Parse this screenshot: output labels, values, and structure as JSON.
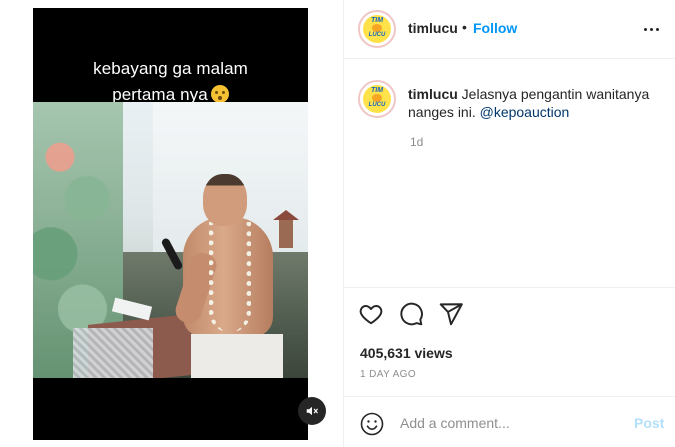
{
  "video": {
    "caption_line1": "kebayang ga malam",
    "caption_line2": "pertama nya",
    "caption_emoji": "flushed-face-emoji",
    "mute_icon": "speaker-muted-icon"
  },
  "post": {
    "username": "timlucu",
    "separator": "•",
    "follow_label": "Follow",
    "more_icon": "more-horizontal-icon",
    "avatar_logo_top": "TIM",
    "avatar_logo_bottom": "LUCU"
  },
  "caption": {
    "username": "timlucu",
    "text": "Jelasnya pengantin wanitanya nanges ini.",
    "mention": "@kepoauction",
    "time": "1d"
  },
  "actions": {
    "like_icon": "heart-icon",
    "comment_icon": "comment-icon",
    "share_icon": "send-icon",
    "views": "405,631 views",
    "posted_ago": "1 DAY AGO"
  },
  "add_comment": {
    "emoji_icon": "smiley-icon",
    "placeholder": "Add a comment...",
    "post_label": "Post"
  },
  "colors": {
    "link_blue": "#0095f6",
    "post_disabled": "#b2dffc",
    "muted_text": "#8e8e8e",
    "mention": "#00376b"
  }
}
